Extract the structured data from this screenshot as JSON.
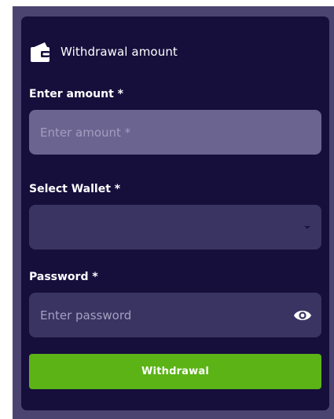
{
  "header": {
    "title": "Withdrawal amount",
    "icon": "wallet-icon"
  },
  "amount": {
    "label": "Enter amount *",
    "placeholder": "Enter amount *"
  },
  "wallet": {
    "label": "Select Wallet *",
    "selected_value": ""
  },
  "password": {
    "label": "Password *",
    "placeholder": "Enter password"
  },
  "submit": {
    "label": "Withdrawal"
  },
  "colors": {
    "page_bg": "#4b4470",
    "card_bg": "#160f3c",
    "input_active": "#6b6490",
    "input_bg": "#3a3463",
    "accent_green": "#5bb315",
    "text": "#ffffff"
  }
}
